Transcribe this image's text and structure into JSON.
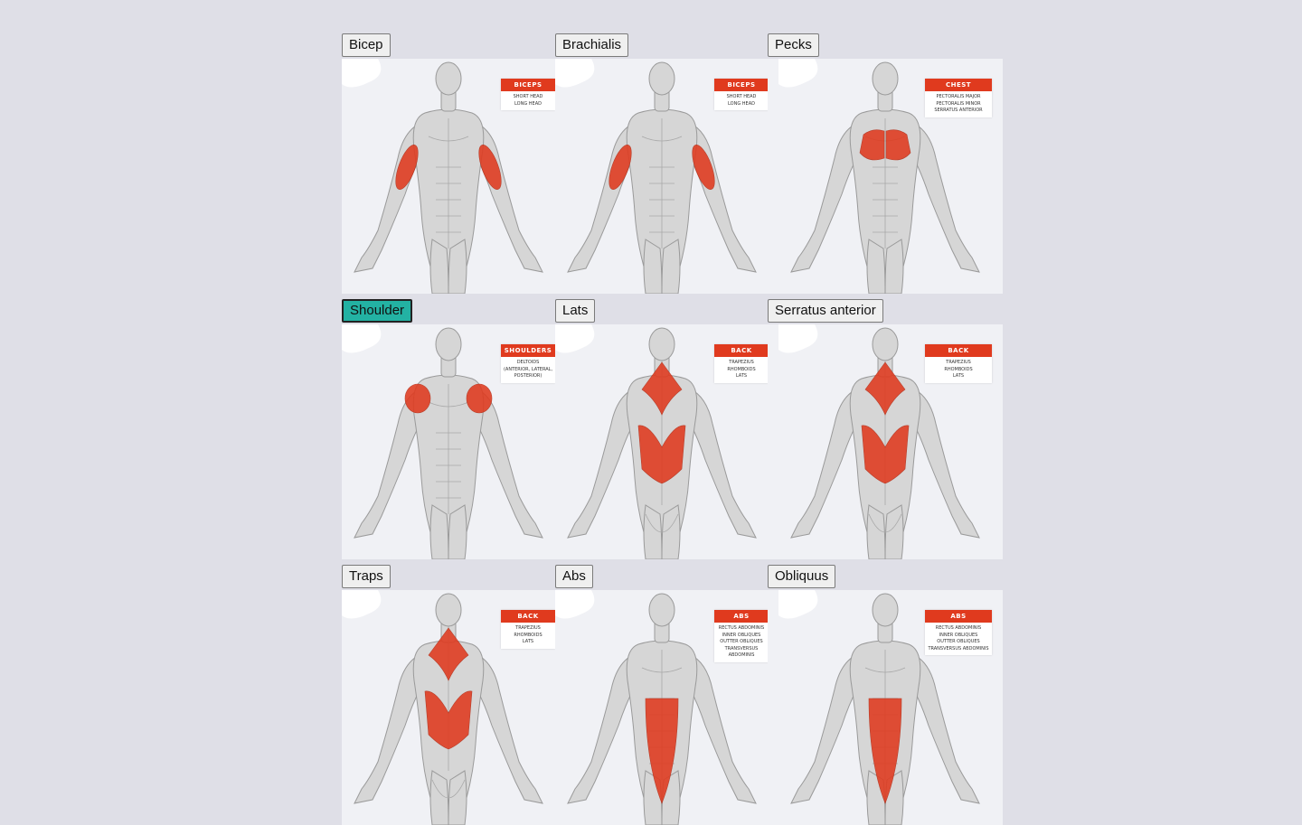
{
  "colors": {
    "page_bg": "#dfdfe7",
    "tile_bg": "#f0f1f5",
    "muscle_highlight": "#e03a1e",
    "active_button": "#23b2a3"
  },
  "tiles": [
    {
      "button": "Bicep",
      "view": "front",
      "highlight": "biceps",
      "label_head": "BICEPS",
      "label_sub": "SHORT HEAD\nLONG HEAD",
      "active": false
    },
    {
      "button": "Brachialis",
      "view": "front",
      "highlight": "biceps",
      "label_head": "BICEPS",
      "label_sub": "SHORT HEAD\nLONG HEAD",
      "active": false
    },
    {
      "button": "Pecks",
      "view": "front",
      "highlight": "chest",
      "label_head": "CHEST",
      "label_sub": "PECTORALIS MAJOR\nPECTORALIS MINOR\nSERRATUS ANTERIOR",
      "active": false
    },
    {
      "button": "Shoulder",
      "view": "front",
      "highlight": "shoulders",
      "label_head": "SHOULDERS",
      "label_sub": "DELTOIDS\n(ANTERIOR, LATERAL,\nPOSTERIOR)",
      "active": true
    },
    {
      "button": "Lats",
      "view": "back",
      "highlight": "back",
      "label_head": "BACK",
      "label_sub": "TRAPEZIUS\nRHOMBOIDS\nLATS",
      "active": false
    },
    {
      "button": "Serratus anterior",
      "view": "back",
      "highlight": "back",
      "label_head": "BACK",
      "label_sub": "TRAPEZIUS\nRHOMBOIDS\nLATS",
      "active": false
    },
    {
      "button": "Traps",
      "view": "back",
      "highlight": "back",
      "label_head": "BACK",
      "label_sub": "TRAPEZIUS\nRHOMBOIDS\nLATS",
      "active": false
    },
    {
      "button": "Abs",
      "view": "front",
      "highlight": "abs",
      "label_head": "ABS",
      "label_sub": "RECTUS ABDOMINIS\nINNER OBLIQUES\nOUTTER OBLIQUES\nTRANSVERSUS ABDOMINIS",
      "active": false
    },
    {
      "button": "Obliquus",
      "view": "front",
      "highlight": "abs",
      "label_head": "ABS",
      "label_sub": "RECTUS ABDOMINIS\nINNER OBLIQUES\nOUTTER OBLIQUES\nTRANSVERSUS ABDOMINIS",
      "active": false
    }
  ]
}
